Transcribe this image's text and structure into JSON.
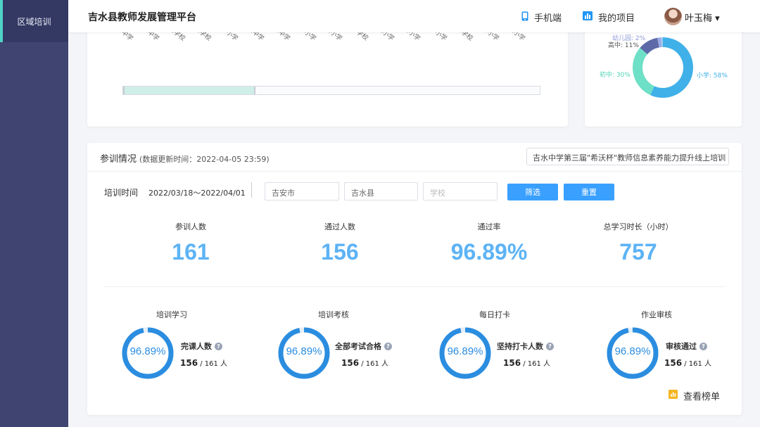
{
  "sidebar": {
    "items": [
      {
        "label": "区域培训",
        "active": true
      }
    ]
  },
  "header": {
    "title": "吉水县教师发展管理平台",
    "mobile_label": "手机端",
    "projects_label": "我的项目",
    "user_name": "叶玉梅 ▾"
  },
  "colors": {
    "accent": "#3aa0ff",
    "sidebar": "#3f4570",
    "ring": "#2b8de0",
    "stat": "#5db3f5"
  },
  "school_chart": {
    "labels": [
      "吉水中学",
      "第二中学",
      "思源实验学校",
      "金滩学校",
      "八都小学",
      "第五中学",
      "第三中学",
      "文峰小学",
      "枫田小学",
      "文峰镇中心学校",
      "金滩小学",
      "水南小学",
      "白沙小学",
      "进士学校",
      "醪桥小学",
      "丁江小学"
    ]
  },
  "pie_chart": {
    "type": "pie",
    "labels": [
      "小学: 58%",
      "初中: 30%",
      "高中: 11%",
      "幼儿园: 2%",
      "1%"
    ],
    "values": [
      58,
      30,
      11,
      2,
      1
    ],
    "colors": [
      "#3fb0e8",
      "#6ee0c7",
      "#5d6aa8",
      "#9aa9e6",
      "#a0ccee"
    ]
  },
  "training": {
    "title": "参训情况",
    "updated": "(数据更新时间：2022-04-05 23:59)",
    "project": "吉水中学第三届\"希沃杯\"教师信息素养能力提升线上培训",
    "filter_label": "培训时间",
    "date_range": "2022/03/18～2022/04/01",
    "city": "吉安市",
    "county": "吉水县",
    "school_placeholder": "学校",
    "filter_button": "筛选",
    "reset_button": "重置",
    "stats": [
      {
        "label": "参训人数",
        "value": "161"
      },
      {
        "label": "通过人数",
        "value": "156"
      },
      {
        "label": "通过率",
        "value": "96.89%"
      },
      {
        "label": "总学习时长（小时）",
        "value": "757"
      }
    ],
    "rings": [
      {
        "group": "培训学习",
        "pct_text": "96.89%",
        "pct": 96.89,
        "title": "完课人数",
        "count": "156",
        "total": " / 161 人"
      },
      {
        "group": "培训考核",
        "pct_text": "96.89%",
        "pct": 96.89,
        "title": "全部考试合格",
        "count": "156",
        "total": " / 161 人"
      },
      {
        "group": "每日打卡",
        "pct_text": "96.89%",
        "pct": 96.89,
        "title": "坚持打卡人数",
        "count": "156",
        "total": " / 161 人"
      },
      {
        "group": "作业审核",
        "pct_text": "96.89%",
        "pct": 96.89,
        "title": "审核通过",
        "count": "156",
        "total": " / 161 人"
      }
    ],
    "rank_link": "查看榜单"
  }
}
